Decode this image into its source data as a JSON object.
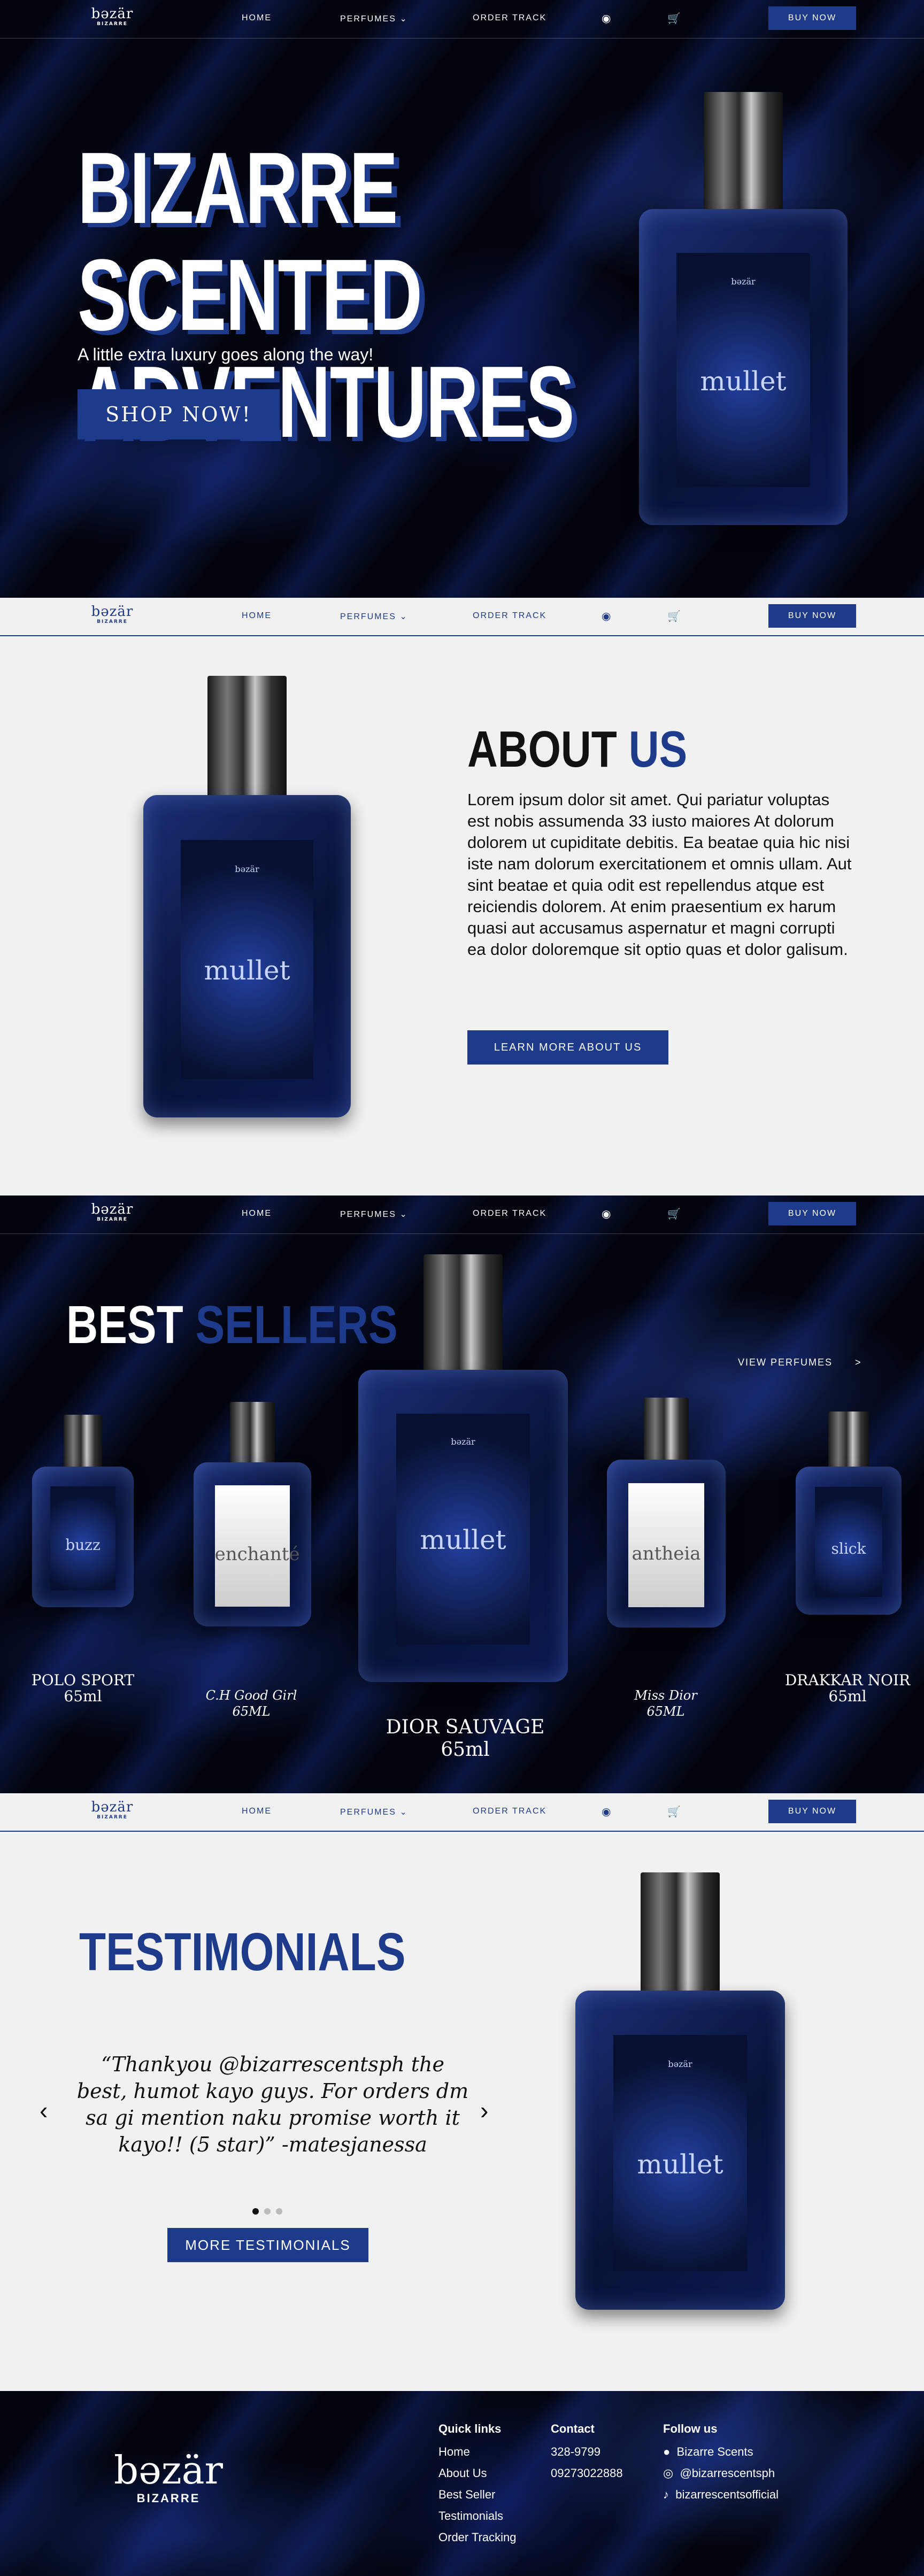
{
  "nav": {
    "logo": "bəzär",
    "logo_sub": "BIZARRE",
    "home": "HOME",
    "perfumes": "PERFUMES",
    "chev": "⌄",
    "order": "ORDER TRACK",
    "chat_icon": "chat-icon",
    "cart_icon": "cart-icon",
    "buy": "BUY NOW"
  },
  "hero": {
    "title_line1": "BIZARRE SCENTED",
    "title_line2": "ADVENTURES",
    "subtitle": "A little extra luxury goes along the way!",
    "cta": "SHOP NOW!"
  },
  "bottles": {
    "brand": "bəzär",
    "mullet": "mullet",
    "buzz": "buzz",
    "enchante": "enchanté",
    "antheia": "antheia",
    "slick": "slick"
  },
  "about": {
    "title_a": "ABOUT",
    "title_b": "US",
    "body": "Lorem ipsum dolor sit amet. Qui pariatur voluptas est nobis assumenda 33 iusto maiores At dolorum dolorem ut cupiditate debitis. Ea beatae quia hic nisi iste nam dolorum exercitationem et omnis ullam. Aut sint beatae et quia odit est repellendus atque est reiciendis dolorem. At enim praesentium ex harum quasi aut accusamus aspernatur et magni corrupti ea dolor doloremque sit optio quas et dolor galisum.",
    "cta": "LEARN MORE ABOUT US"
  },
  "best": {
    "title_a": "BEST",
    "title_b": "SELLERS",
    "view": "VIEW PERFUMES",
    "view_arrow": ">",
    "products": [
      {
        "name": "POLO SPORT",
        "size": "65ml"
      },
      {
        "name": "C.H Good Girl",
        "size": "65ML"
      },
      {
        "name": "DIOR SAUVAGE",
        "size": "65ml"
      },
      {
        "name": "Miss Dior",
        "size": "65ML"
      },
      {
        "name": "DRAKKAR NOIR",
        "size": "65ml"
      }
    ]
  },
  "testi": {
    "title": "TESTIMONIALS",
    "quote": "“Thankyou @bizarrescentsph the best, humot kayo guys. For orders dm sa gi mention naku promise worth it kayo!! (5 star)”        -matesjanessa",
    "prev": "‹",
    "next": "›",
    "cta": "MORE TESTIMONIALS"
  },
  "footer": {
    "logo": "bəzär",
    "logo_sub": "BIZARRE",
    "quick_title": "Quick links",
    "quick": [
      "Home",
      "About Us",
      "Best Seller",
      "Testimonials",
      "Order Tracking"
    ],
    "contact_title": "Contact",
    "contact": [
      "328-9799",
      "09273022888"
    ],
    "follow_title": "Follow us",
    "follow": [
      "Bizarre Scents",
      "@bizarrescentsph",
      "bizarrescentsofficial"
    ],
    "icons": [
      "facebook-icon",
      "instagram-icon",
      "tiktok-icon"
    ]
  },
  "colors": {
    "accent": "#1e3a8a",
    "dark": "#02040c",
    "light_bg": "#f1f1f1"
  }
}
